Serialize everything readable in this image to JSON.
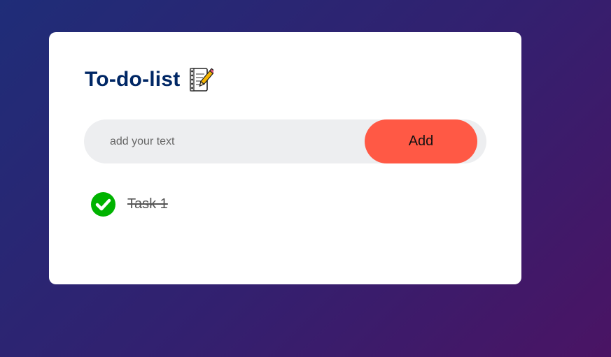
{
  "app": {
    "title": "To-do-list",
    "title_icon": "notebook-with-pencil-icon"
  },
  "input": {
    "placeholder": "add your text",
    "value": ""
  },
  "add_button": {
    "label": "Add"
  },
  "tasks": [
    {
      "label": "Task 1",
      "checked": true,
      "icon": "checked-circle-icon"
    }
  ],
  "colors": {
    "accent": "#ff5945",
    "title": "#002765",
    "check": "#00b300",
    "input_bg": "#edeef0"
  }
}
